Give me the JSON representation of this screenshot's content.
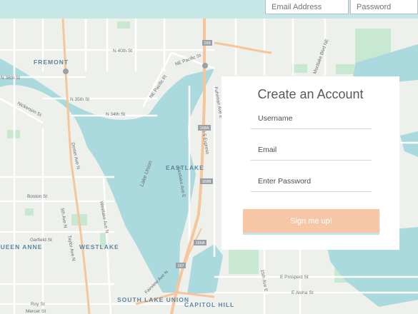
{
  "header": {
    "email_placeholder": "Email Address",
    "password_placeholder": "Password"
  },
  "signup_card": {
    "title": "Create an Account",
    "username_label": "Username",
    "email_label": "Email",
    "password_label": "Enter Password",
    "submit_label": "Sign me up!"
  },
  "map": {
    "neighborhoods": [
      "FREMONT",
      "EASTLAKE",
      "WESTLAKE",
      "QUEEN ANNE",
      "SOUTH LAKE UNION",
      "CAPITOL HILL"
    ],
    "lake": "Lake Union",
    "streets": [
      "N 40th St",
      "N 36th St",
      "N 35th St",
      "N 34th St",
      "NE Pacific St",
      "NE Pacific Pl",
      "Nickerson St",
      "Dexter Ave N",
      "Westlake Ave N",
      "Boston St",
      "Garfield St",
      "Fairview Ave N",
      "Eastlake Ave E",
      "I-5 Express",
      "Roy St",
      "Mercer St",
      "E Aloha St",
      "15th Ave E",
      "E Prospect St",
      "Montlake Blvd NE",
      "Taylor Ave N",
      "5th Ave N",
      "Fuhrman Ave E"
    ],
    "highway_shields": [
      "169",
      "168A",
      "168B",
      "166A",
      "167"
    ],
    "colors": {
      "land": "#eef0ec",
      "water": "#aadadd",
      "park": "#c9e8d2",
      "highway": "#f6c59c",
      "road": "#ffffff",
      "label": "#6b6f75",
      "header": "#c6e7e6",
      "button": "#f7c6a7"
    }
  }
}
